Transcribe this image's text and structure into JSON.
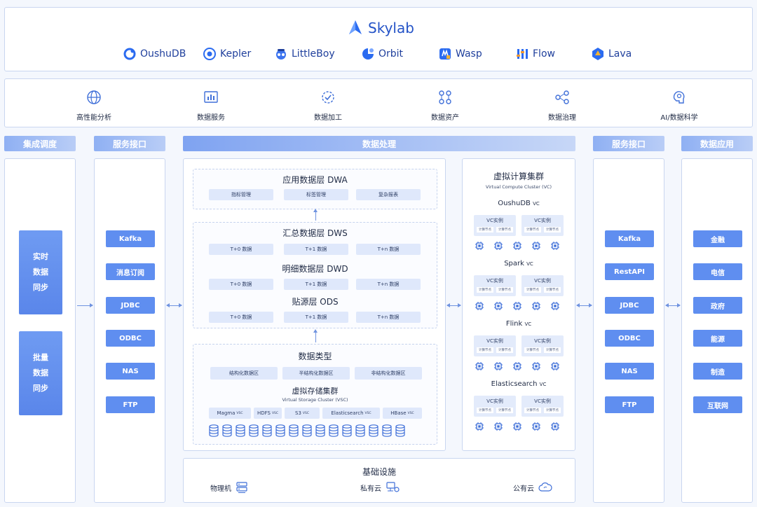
{
  "brand": {
    "top": "Skylab",
    "products": [
      "OushuDB",
      "Kepler",
      "LittleBoy",
      "Orbit",
      "Wasp",
      "Flow",
      "Lava"
    ]
  },
  "capabilities": [
    "高性能分析",
    "数据服务",
    "数据加工",
    "数据资产",
    "数据治理",
    "AI/数据科学"
  ],
  "headers": {
    "integration": "集成调度",
    "service_left": "服务接口",
    "processing": "数据处理",
    "service_right": "服务接口",
    "application": "数据应用"
  },
  "integration": {
    "realtime": [
      "实时",
      "数据",
      "同步"
    ],
    "batch": [
      "批量",
      "数据",
      "同步"
    ]
  },
  "service_left_items": [
    "Kafka",
    "消息订阅",
    "JDBC",
    "ODBC",
    "NAS",
    "FTP"
  ],
  "service_right_items": [
    "Kafka",
    "RestAPI",
    "JDBC",
    "ODBC",
    "NAS",
    "FTP"
  ],
  "application_items": [
    "金融",
    "电信",
    "政府",
    "能源",
    "制造",
    "互联网"
  ],
  "layers": {
    "dwa": {
      "title": "应用数据层 DWA",
      "chips": [
        "指标管理",
        "标签管理",
        "复杂报表"
      ]
    },
    "dws": {
      "title": "汇总数据层 DWS",
      "chips": [
        "T+0 数据",
        "T+1 数据",
        "T+n 数据"
      ]
    },
    "dwd": {
      "title": "明细数据层 DWD",
      "chips": [
        "T+0 数据",
        "T+1 数据",
        "T+n 数据"
      ]
    },
    "ods": {
      "title": "贴源层 ODS",
      "chips": [
        "T+0 数据",
        "T+1 数据",
        "T+n 数据"
      ]
    }
  },
  "datatypes": {
    "title": "数据类型",
    "chips": [
      "结构化数据区",
      "半结构化数据区",
      "非结构化数据区"
    ]
  },
  "vsc": {
    "title": "虚拟存储集群",
    "subtitle": "Virtual  Storage Cluster (VSC)",
    "items": [
      {
        "name": "Magma",
        "suffix": "VSC"
      },
      {
        "name": "HDFS",
        "suffix": "VSC"
      },
      {
        "name": "S3",
        "suffix": "VSC"
      },
      {
        "name": "Elasticsearch",
        "suffix": "VSC"
      },
      {
        "name": "HBase",
        "suffix": "VSC"
      }
    ]
  },
  "vc": {
    "title": "虚拟计算集群",
    "subtitle": "Virtual  Compute Cluster (VC)",
    "instance_label": "VC实例",
    "node_label": "计算节点",
    "groups": [
      {
        "name": "OushuDB",
        "suffix": "VC"
      },
      {
        "name": "Spark",
        "suffix": "VC"
      },
      {
        "name": "Flink",
        "suffix": "VC"
      },
      {
        "name": "Elasticsearch",
        "suffix": "VC"
      }
    ]
  },
  "infra": {
    "title": "基础设施",
    "items": [
      "物理机",
      "私有云",
      "公有云"
    ]
  }
}
